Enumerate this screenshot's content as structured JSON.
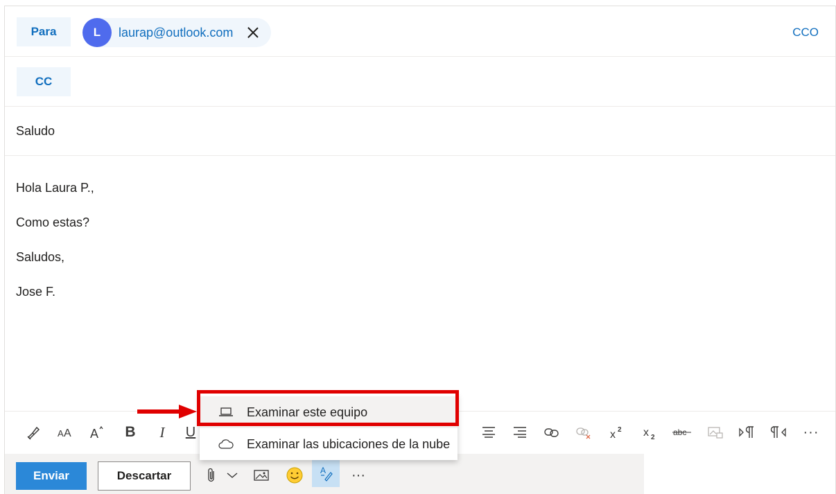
{
  "to_row": {
    "label": "Para",
    "recipient_initial": "L",
    "recipient_email": "laurap@outlook.com",
    "bcc_label": "CCO"
  },
  "cc_row": {
    "label": "CC"
  },
  "subject": "Saludo",
  "body_lines": [
    "Hola Laura P.,",
    "Como estas?",
    "Saludos,",
    "Jose F."
  ],
  "attach_menu": {
    "items": [
      {
        "label": "Examinar este equipo",
        "icon": "laptop-icon"
      },
      {
        "label": "Examinar las ubicaciones de la nube",
        "icon": "cloud-icon"
      }
    ]
  },
  "format_toolbar": {
    "bold": "B",
    "italic": "I",
    "underline": "U",
    "more": "···"
  },
  "actions": {
    "send": "Enviar",
    "discard": "Descartar",
    "more": "···"
  },
  "colors": {
    "accent": "#2b88d8",
    "link": "#106ebe",
    "avatar": "#4f6bed",
    "highlight": "#e00000"
  }
}
